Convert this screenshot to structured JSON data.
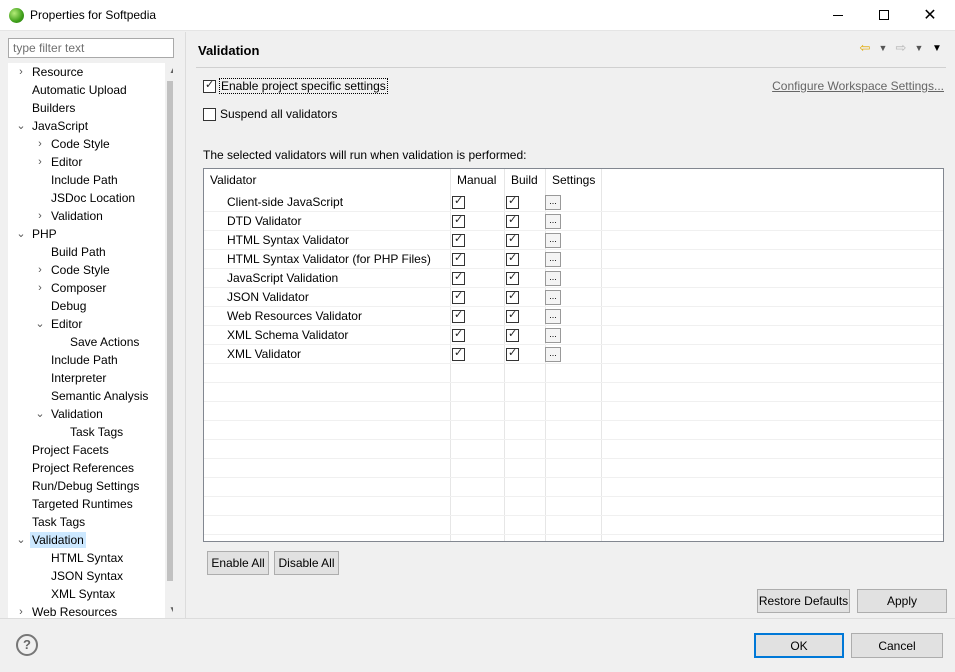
{
  "window": {
    "title": "Properties for Softpedia",
    "minimize_icon": "minimize-icon",
    "maximize_icon": "maximize-icon",
    "close_icon": "close-icon"
  },
  "filter": {
    "placeholder": "type filter text",
    "value": ""
  },
  "tree": [
    {
      "label": "Resource",
      "level": 0,
      "twisty": "collapsed"
    },
    {
      "label": "Automatic Upload",
      "level": 0,
      "twisty": "none"
    },
    {
      "label": "Builders",
      "level": 0,
      "twisty": "none"
    },
    {
      "label": "JavaScript",
      "level": 0,
      "twisty": "expanded"
    },
    {
      "label": "Code Style",
      "level": 1,
      "twisty": "collapsed"
    },
    {
      "label": "Editor",
      "level": 1,
      "twisty": "collapsed"
    },
    {
      "label": "Include Path",
      "level": 1,
      "twisty": "none"
    },
    {
      "label": "JSDoc Location",
      "level": 1,
      "twisty": "none"
    },
    {
      "label": "Validation",
      "level": 1,
      "twisty": "collapsed"
    },
    {
      "label": "PHP",
      "level": 0,
      "twisty": "expanded"
    },
    {
      "label": "Build Path",
      "level": 1,
      "twisty": "none"
    },
    {
      "label": "Code Style",
      "level": 1,
      "twisty": "collapsed"
    },
    {
      "label": "Composer",
      "level": 1,
      "twisty": "collapsed"
    },
    {
      "label": "Debug",
      "level": 1,
      "twisty": "none"
    },
    {
      "label": "Editor",
      "level": 1,
      "twisty": "expanded"
    },
    {
      "label": "Save Actions",
      "level": 2,
      "twisty": "none"
    },
    {
      "label": "Include Path",
      "level": 1,
      "twisty": "none"
    },
    {
      "label": "Interpreter",
      "level": 1,
      "twisty": "none"
    },
    {
      "label": "Semantic Analysis",
      "level": 1,
      "twisty": "none"
    },
    {
      "label": "Validation",
      "level": 1,
      "twisty": "expanded"
    },
    {
      "label": "Task Tags",
      "level": 2,
      "twisty": "none"
    },
    {
      "label": "Project Facets",
      "level": 0,
      "twisty": "none"
    },
    {
      "label": "Project References",
      "level": 0,
      "twisty": "none"
    },
    {
      "label": "Run/Debug Settings",
      "level": 0,
      "twisty": "none"
    },
    {
      "label": "Targeted Runtimes",
      "level": 0,
      "twisty": "none"
    },
    {
      "label": "Task Tags",
      "level": 0,
      "twisty": "none"
    },
    {
      "label": "Validation",
      "level": 0,
      "twisty": "expanded",
      "selected": true
    },
    {
      "label": "HTML Syntax",
      "level": 1,
      "twisty": "none"
    },
    {
      "label": "JSON Syntax",
      "level": 1,
      "twisty": "none"
    },
    {
      "label": "XML Syntax",
      "level": 1,
      "twisty": "none"
    },
    {
      "label": "Web Resources",
      "level": 0,
      "twisty": "collapsed"
    }
  ],
  "page": {
    "title": "Validation",
    "back_icon": "back-arrow-icon",
    "forward_icon": "forward-arrow-icon",
    "menu_icon": "view-menu-icon",
    "enable_project_settings": {
      "label": "Enable project specific settings",
      "checked": true
    },
    "suspend_validators": {
      "label": "Suspend all validators",
      "checked": false
    },
    "configure_link": "Configure Workspace Settings...",
    "description": "The selected validators will run when validation is performed:",
    "columns": [
      "Validator",
      "Manual",
      "Build",
      "Settings"
    ],
    "settings_button_label": "...",
    "validators": [
      {
        "name": "Client-side JavaScript",
        "manual": true,
        "build": true
      },
      {
        "name": "DTD Validator",
        "manual": true,
        "build": true
      },
      {
        "name": "HTML Syntax Validator",
        "manual": true,
        "build": true
      },
      {
        "name": "HTML Syntax Validator (for PHP Files)",
        "manual": true,
        "build": true
      },
      {
        "name": "JavaScript Validation",
        "manual": true,
        "build": true
      },
      {
        "name": "JSON Validator",
        "manual": true,
        "build": true
      },
      {
        "name": "Web Resources Validator",
        "manual": true,
        "build": true
      },
      {
        "name": "XML Schema Validator",
        "manual": true,
        "build": true
      },
      {
        "name": "XML Validator",
        "manual": true,
        "build": true
      }
    ],
    "enable_all": "Enable All",
    "disable_all": "Disable All",
    "restore_defaults": "Restore Defaults",
    "apply": "Apply"
  },
  "footer": {
    "help_icon": "help-icon",
    "ok": "OK",
    "cancel": "Cancel"
  }
}
